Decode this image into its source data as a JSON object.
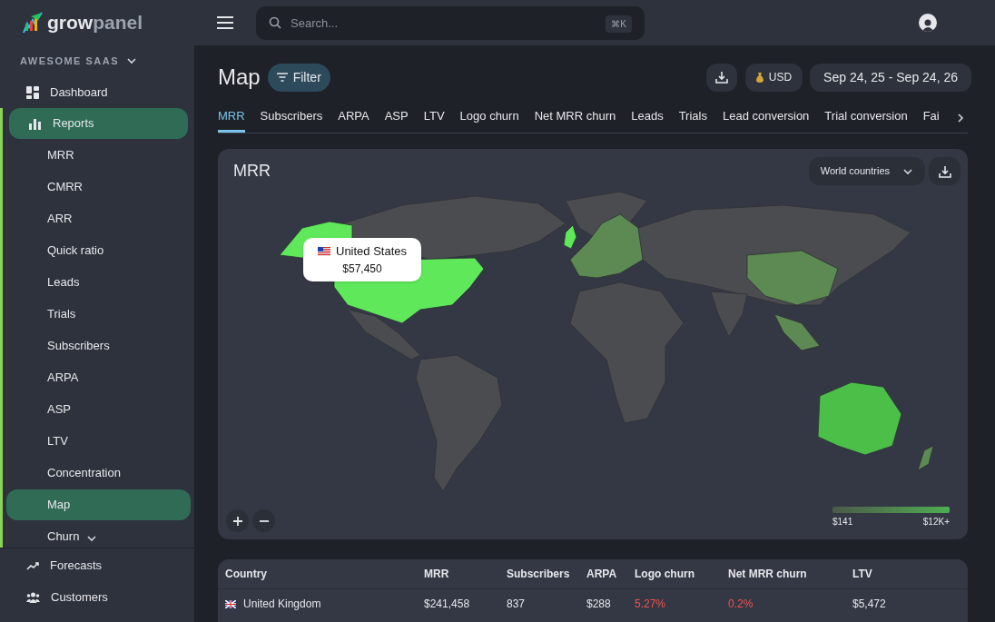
{
  "logo": {
    "part1": "grow",
    "part2": "panel"
  },
  "workspace": "AWESOME SAAS",
  "search": {
    "placeholder": "Search...",
    "shortcut": "⌘K"
  },
  "sidebar": {
    "items": [
      {
        "label": "Dashboard",
        "selected": false
      },
      {
        "label": "Reports",
        "selected": true,
        "children": [
          {
            "label": "MRR",
            "selected": false
          },
          {
            "label": "CMRR",
            "selected": false
          },
          {
            "label": "ARR",
            "selected": false
          },
          {
            "label": "Quick ratio",
            "selected": false
          },
          {
            "label": "Leads",
            "selected": false
          },
          {
            "label": "Trials",
            "selected": false
          },
          {
            "label": "Subscribers",
            "selected": false
          },
          {
            "label": "ARPA",
            "selected": false
          },
          {
            "label": "ASP",
            "selected": false
          },
          {
            "label": "LTV",
            "selected": false
          },
          {
            "label": "Concentration",
            "selected": false
          },
          {
            "label": "Map",
            "selected": true
          },
          {
            "label": "Churn",
            "selected": false,
            "expanded": false
          }
        ]
      },
      {
        "label": "Forecasts",
        "selected": false
      },
      {
        "label": "Customers",
        "selected": false
      }
    ]
  },
  "page": {
    "title": "Map",
    "filter": "Filter",
    "currency": "USD",
    "date_range": "Sep 24, 25 - Sep 24, 26"
  },
  "tabs": [
    {
      "label": "MRR",
      "selected": true
    },
    {
      "label": "Subscribers",
      "selected": false
    },
    {
      "label": "ARPA",
      "selected": false
    },
    {
      "label": "ASP",
      "selected": false
    },
    {
      "label": "LTV",
      "selected": false
    },
    {
      "label": "Logo churn",
      "selected": false
    },
    {
      "label": "Net MRR churn",
      "selected": false
    },
    {
      "label": "Leads",
      "selected": false
    },
    {
      "label": "Trials",
      "selected": false
    },
    {
      "label": "Lead conversion",
      "selected": false
    },
    {
      "label": "Trial conversion",
      "selected": false
    },
    {
      "label": "Fai",
      "selected": false
    }
  ],
  "map_card": {
    "title": "MRR",
    "region_select": "World countries",
    "tooltip": {
      "country": "United States",
      "value": "$57,450"
    },
    "legend": {
      "min": "$141",
      "max": "$12K+"
    }
  },
  "table": {
    "columns": [
      "Country",
      "MRR",
      "Subscribers",
      "ARPA",
      "Logo churn",
      "Net MRR churn",
      "LTV"
    ],
    "rows": [
      {
        "cells": [
          {
            "text": "United Kingdom"
          },
          {
            "text": "$241,458"
          },
          {
            "text": "837"
          },
          {
            "text": "$288"
          },
          {
            "text": "5.27%",
            "color": "#ef5350"
          },
          {
            "text": "0.2%",
            "color": "#ef5350"
          },
          {
            "text": "$5,472"
          }
        ]
      }
    ]
  }
}
